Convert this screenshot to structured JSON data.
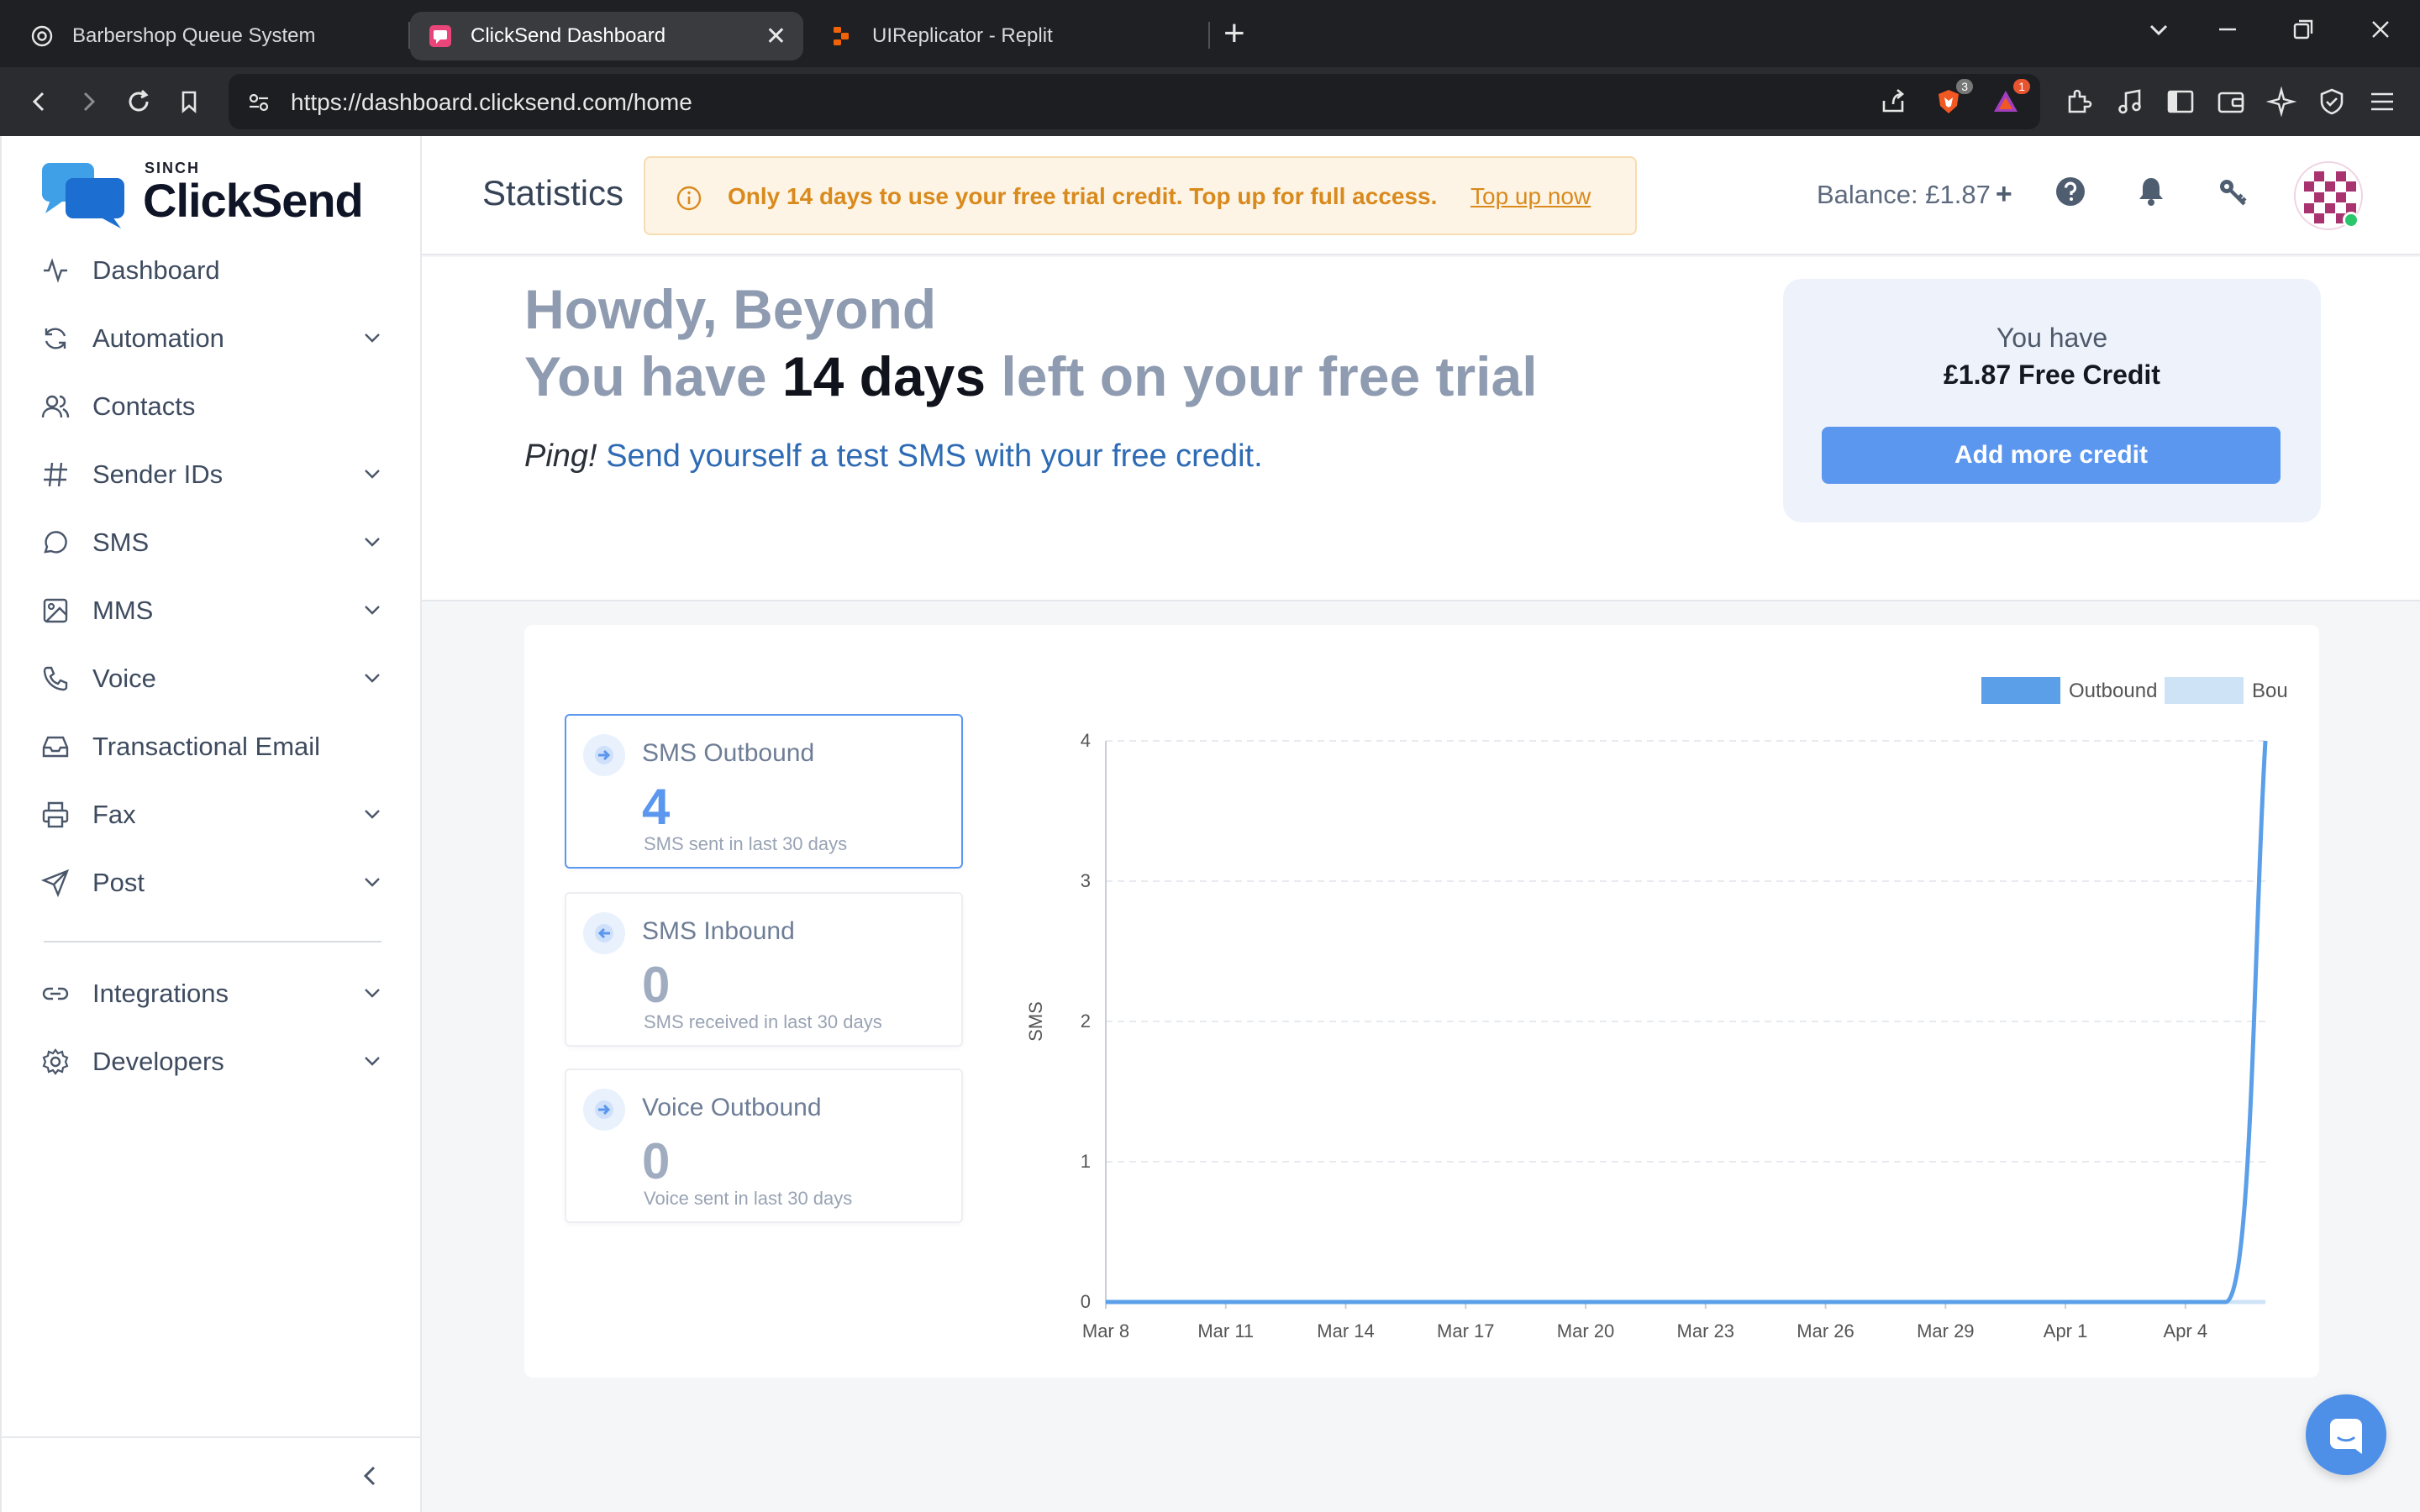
{
  "browser": {
    "tabs": [
      {
        "title": "Barbershop Queue System"
      },
      {
        "title": "ClickSend Dashboard"
      },
      {
        "title": "UIReplicator - Replit"
      }
    ],
    "url": "https://dashboard.clicksend.com/home",
    "brave_badge": "3",
    "alert_badge": "1"
  },
  "logo": {
    "small": "SINCH",
    "brand": "ClickSend"
  },
  "sidebar": {
    "items": [
      {
        "label": "Dashboard",
        "icon": "activity-icon",
        "expandable": false
      },
      {
        "label": "Automation",
        "icon": "refresh-icon",
        "expandable": true
      },
      {
        "label": "Contacts",
        "icon": "users-icon",
        "expandable": false
      },
      {
        "label": "Sender IDs",
        "icon": "hash-icon",
        "expandable": true
      },
      {
        "label": "SMS",
        "icon": "message-icon",
        "expandable": true
      },
      {
        "label": "MMS",
        "icon": "image-icon",
        "expandable": true
      },
      {
        "label": "Voice",
        "icon": "phone-icon",
        "expandable": true
      },
      {
        "label": "Transactional Email",
        "icon": "inbox-icon",
        "expandable": false
      },
      {
        "label": "Fax",
        "icon": "printer-icon",
        "expandable": true
      },
      {
        "label": "Post",
        "icon": "send-icon",
        "expandable": true
      },
      {
        "label": "Integrations",
        "icon": "link-icon",
        "expandable": true
      },
      {
        "label": "Developers",
        "icon": "gear-icon",
        "expandable": true
      }
    ]
  },
  "topbar": {
    "title": "Statistics",
    "alert_text": "Only 14 days to use your free trial credit. Top up for full access.",
    "alert_link": "Top up now",
    "balance": "Balance: £1.87",
    "balance_plus": "+"
  },
  "hero": {
    "greeting": "Howdy, Beyond",
    "trial_pre": "You have",
    "trial_days": "14 days",
    "trial_post": "left on your free trial",
    "ping_em": "Ping!",
    "ping_text": "Send yourself a test SMS with your free credit."
  },
  "credit": {
    "line1": "You have",
    "line2": "£1.87 Free Credit",
    "button": "Add more credit"
  },
  "stats": [
    {
      "label": "SMS Outbound",
      "value": "4",
      "sub": "SMS sent in last 30 days"
    },
    {
      "label": "SMS Inbound",
      "value": "0",
      "sub": "SMS received in last 30 days"
    },
    {
      "label": "Voice Outbound",
      "value": "0",
      "sub": "Voice sent in last 30 days"
    }
  ],
  "colors": {
    "accent": "#5b96ef",
    "outbound": "#5b9fe9",
    "bounced": "#cfe3f7",
    "alert": "#d98a1d"
  },
  "chart_data": {
    "type": "line",
    "ylabel": "SMS",
    "xlabel": "",
    "x_ticks": [
      "Mar 8",
      "Mar 11",
      "Mar 14",
      "Mar 17",
      "Mar 20",
      "Mar 23",
      "Mar 26",
      "Mar 29",
      "Apr 1",
      "Apr 4"
    ],
    "ylim": [
      0,
      4
    ],
    "y_ticks": [
      "0",
      "1",
      "2",
      "3",
      "4"
    ],
    "x": [
      "Mar 8",
      "Mar 9",
      "Mar 10",
      "Mar 11",
      "Mar 12",
      "Mar 13",
      "Mar 14",
      "Mar 15",
      "Mar 16",
      "Mar 17",
      "Mar 18",
      "Mar 19",
      "Mar 20",
      "Mar 21",
      "Mar 22",
      "Mar 23",
      "Mar 24",
      "Mar 25",
      "Mar 26",
      "Mar 27",
      "Mar 28",
      "Mar 29",
      "Mar 30",
      "Mar 31",
      "Apr 1",
      "Apr 2",
      "Apr 3",
      "Apr 4",
      "Apr 5",
      "Apr 6"
    ],
    "series": [
      {
        "name": "Outbound",
        "values": [
          0,
          0,
          0,
          0,
          0,
          0,
          0,
          0,
          0,
          0,
          0,
          0,
          0,
          0,
          0,
          0,
          0,
          0,
          0,
          0,
          0,
          0,
          0,
          0,
          0,
          0,
          0,
          0,
          0,
          4
        ]
      },
      {
        "name": "Bounced",
        "values": [
          0,
          0,
          0,
          0,
          0,
          0,
          0,
          0,
          0,
          0,
          0,
          0,
          0,
          0,
          0,
          0,
          0,
          0,
          0,
          0,
          0,
          0,
          0,
          0,
          0,
          0,
          0,
          0,
          0,
          0
        ]
      }
    ],
    "grid": true,
    "legend": "top-right"
  }
}
